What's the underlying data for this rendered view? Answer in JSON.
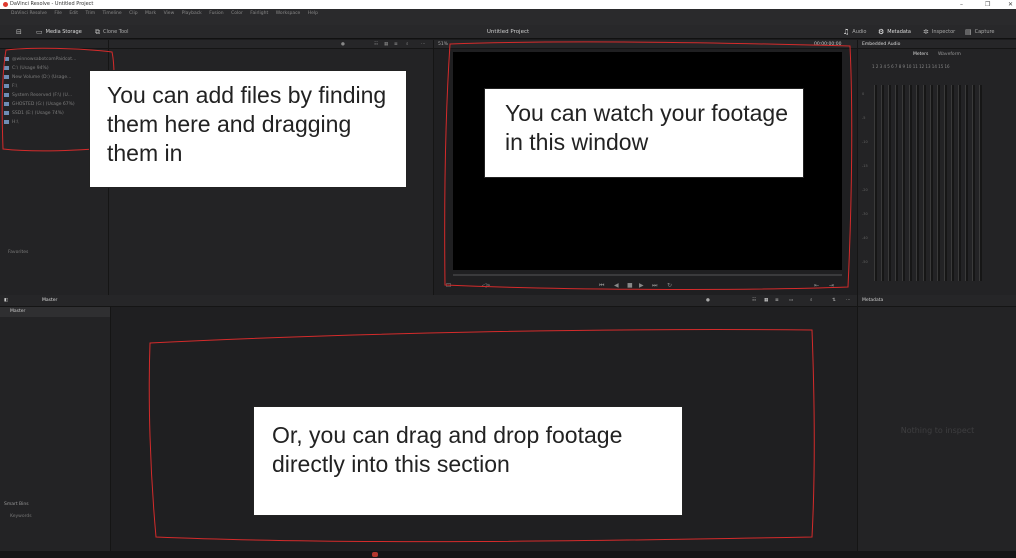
{
  "window": {
    "title": "DaVinci Resolve - Untitled Project",
    "minimize": "–",
    "maximize": "❐",
    "close": "✕"
  },
  "menu": [
    "DaVinci Resolve",
    "File",
    "Edit",
    "Trim",
    "Timeline",
    "Clip",
    "Mark",
    "View",
    "Playback",
    "Fusion",
    "Color",
    "Fairlight",
    "Workspace",
    "Help"
  ],
  "toolbar": {
    "media_storage": "Media Storage",
    "clone_tool": "Clone Tool",
    "project_title": "Untitled Project",
    "audio": "Audio",
    "metadata": "Metadata",
    "inspector": "Inspector",
    "capture": "Capture"
  },
  "media_storage": {
    "drives": [
      "@winnowsabotcomPaidcot...",
      "C:\\ (Usage 94%)",
      "New Volume (D:) (Usage...",
      "F:\\",
      "System Reserved (F:\\) (U...",
      "GHOSTED (G:) (Usage 67%)",
      "SSD1 (E:) (Usage 74%)",
      "H:\\"
    ],
    "favorites_label": "Favorites"
  },
  "viewer": {
    "zoom": "51%",
    "timecode": "00:00:00:00"
  },
  "audio_panel": {
    "title": "Embedded Audio",
    "tab_meters": "Meters",
    "tab_waveform": "Waveform",
    "channels": "1  2  3  4  5  6  7  8  9  10  11  12  13  14  15  16",
    "scale": [
      "0",
      "-5",
      "-10",
      "-15",
      "-20",
      "-30",
      "-40",
      "-50"
    ]
  },
  "media_pool": {
    "header": "Master",
    "bin": "Master",
    "smart_bins": "Smart Bins",
    "keywords": "Keywords"
  },
  "metadata_panel": {
    "title": "Metadata",
    "empty_text": "Nothing to inspect"
  },
  "callouts": {
    "files": "You can add files by finding them here and dragging them in",
    "viewer": "You can watch your footage in this window",
    "pool": "Or, you can drag and drop footage directly into this section"
  },
  "colors": {
    "annotation": "#d42b2b",
    "background": "#1c1c1e"
  }
}
